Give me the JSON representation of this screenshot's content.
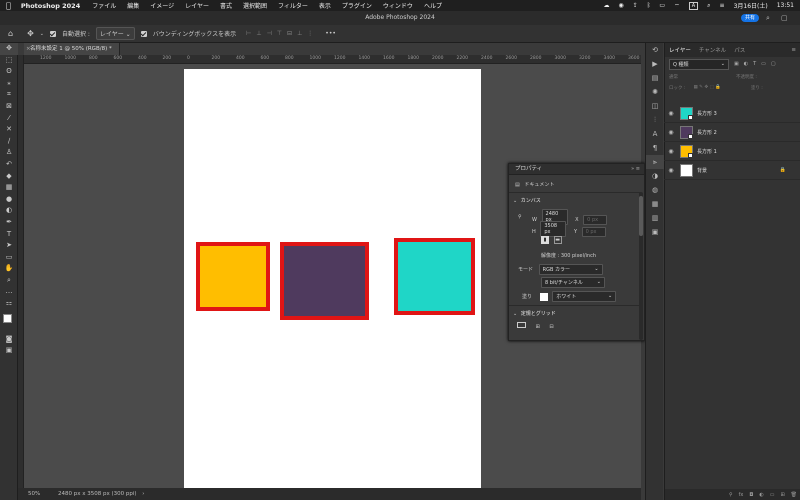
{
  "menubar": {
    "app": "Photoshop 2024",
    "items": [
      "ファイル",
      "編集",
      "イメージ",
      "レイヤー",
      "書式",
      "選択範囲",
      "フィルター",
      "表示",
      "プラグイン",
      "ウィンドウ",
      "ヘルプ"
    ],
    "input_method": "A",
    "date": "3月16日(土)",
    "time": "13:51"
  },
  "window": {
    "title": "Adobe Photoshop 2024"
  },
  "options": {
    "auto_select_label": "自動選択 :",
    "target": "レイヤー",
    "bounding_box_label": "バウンディングボックスを表示",
    "more": "•••"
  },
  "document": {
    "tab": "名称未設定 1 @ 50% (RGB/8) *",
    "ruler_labels": [
      "1200",
      "1000",
      "800",
      "600",
      "400",
      "200",
      "0",
      "200",
      "400",
      "600",
      "800",
      "1000",
      "1200",
      "1400",
      "1600",
      "1800",
      "2000",
      "2200",
      "2400",
      "2600",
      "2800",
      "3000",
      "3200",
      "3400",
      "3600"
    ]
  },
  "shapes": [
    {
      "name": "長方形 1",
      "fill": "#ffbe00",
      "stroke": "#e01515"
    },
    {
      "name": "長方形 2",
      "fill": "#4f3a5e",
      "stroke": "#e01515"
    },
    {
      "name": "長方形 3",
      "fill": "#1fd6c7",
      "stroke": "#e01515"
    }
  ],
  "status": {
    "zoom": "50%",
    "doc_info": "2480 px x 3508 px (300 ppi)"
  },
  "properties": {
    "title": "プロパティ",
    "kind": "ドキュメント",
    "canvas_section": "カンバス",
    "w_label": "W",
    "w_value": "2480 px",
    "h_label": "H",
    "h_value": "3508 px",
    "x_label": "X",
    "y_label": "Y",
    "x_placeholder": "0 px",
    "y_placeholder": "0 px",
    "resolution": "解像度 : 300 pixel/inch",
    "mode_label": "モード",
    "mode_value": "RGB カラー",
    "bits_value": "8 bit/チャンネル",
    "fill_label": "塗り",
    "fill_value": "ホワイト",
    "guides_section": "定規とグリッド"
  },
  "layers_panel": {
    "tabs": [
      "レイヤー",
      "チャンネル",
      "パス"
    ],
    "kind": "Q 種類",
    "blend": "通常",
    "opacity": "不透明度 :",
    "lock": "ロック :",
    "fill": "塗り :",
    "layers": [
      {
        "name": "長方形 3",
        "color": "#1fd6c7"
      },
      {
        "name": "長方形 2",
        "color": "#4f3a5e"
      },
      {
        "name": "長方形 1",
        "color": "#ffbe00"
      },
      {
        "name": "背景",
        "color": "#ffffff"
      }
    ],
    "share": "共有"
  }
}
